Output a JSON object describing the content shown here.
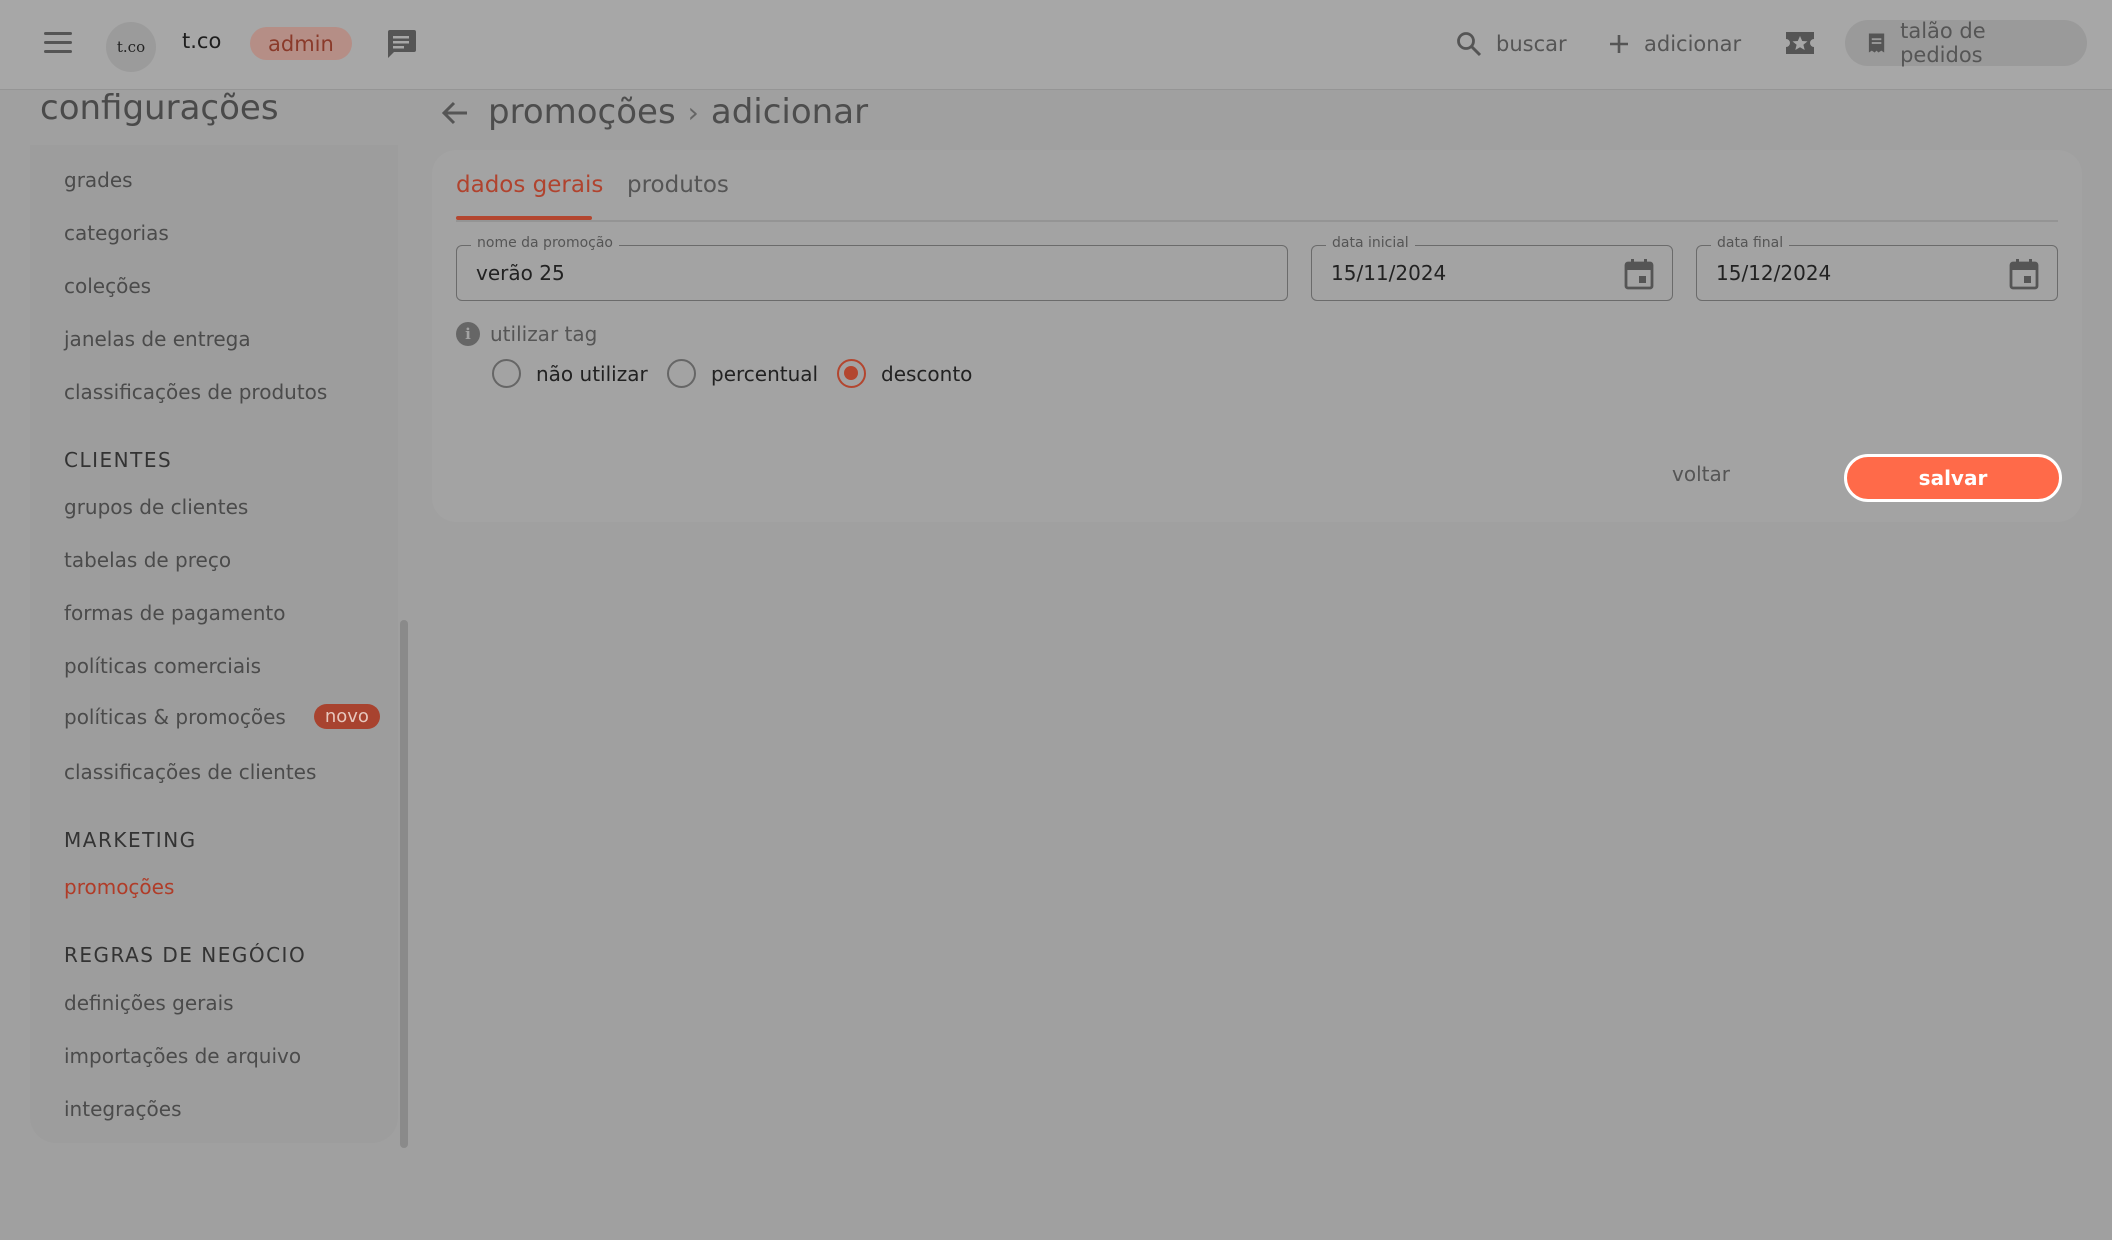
{
  "topbar": {
    "brand": "t.co",
    "logo_text": "t.co",
    "role_badge": "admin",
    "search_label": "buscar",
    "add_label": "adicionar",
    "order_book_label": "talão de pedidos"
  },
  "sidebar": {
    "title": "configurações",
    "groups": [
      {
        "section": "",
        "items": [
          "grades",
          "categorias",
          "coleções",
          "janelas de entrega",
          "classificações de produtos"
        ]
      },
      {
        "section": "CLIENTES",
        "items": [
          "grupos de clientes",
          "tabelas de preço",
          "formas de pagamento",
          "políticas comerciais",
          "políticas & promoções",
          "classificações de clientes"
        ]
      },
      {
        "section": "MARKETING",
        "items": [
          "promoções"
        ]
      },
      {
        "section": "REGRAS DE NEGÓCIO",
        "items": [
          "definições gerais",
          "importações de arquivo",
          "integrações"
        ]
      }
    ],
    "new_badge": "novo",
    "active_item": "promoções"
  },
  "breadcrumb": {
    "parent": "promoções",
    "separator": "›",
    "current": "adicionar"
  },
  "tabs": [
    {
      "label": "dados gerais",
      "active": true
    },
    {
      "label": "produtos",
      "active": false
    }
  ],
  "form": {
    "promo_name": {
      "label": "nome da promoção",
      "value": "verão 25"
    },
    "start_date": {
      "label": "data inicial",
      "value": "15/11/2024"
    },
    "end_date": {
      "label": "data final",
      "value": "15/12/2024"
    },
    "tag_label": "utilizar tag",
    "tag_options": [
      {
        "label": "não utilizar",
        "checked": false
      },
      {
        "label": "percentual",
        "checked": false
      },
      {
        "label": "desconto",
        "checked": true
      }
    ]
  },
  "actions": {
    "back_label": "voltar",
    "save_label": "salvar"
  },
  "colors": {
    "accent": "#b3462f",
    "save_button": "#ff6a49",
    "overlay_background": "#a0a0a0"
  }
}
